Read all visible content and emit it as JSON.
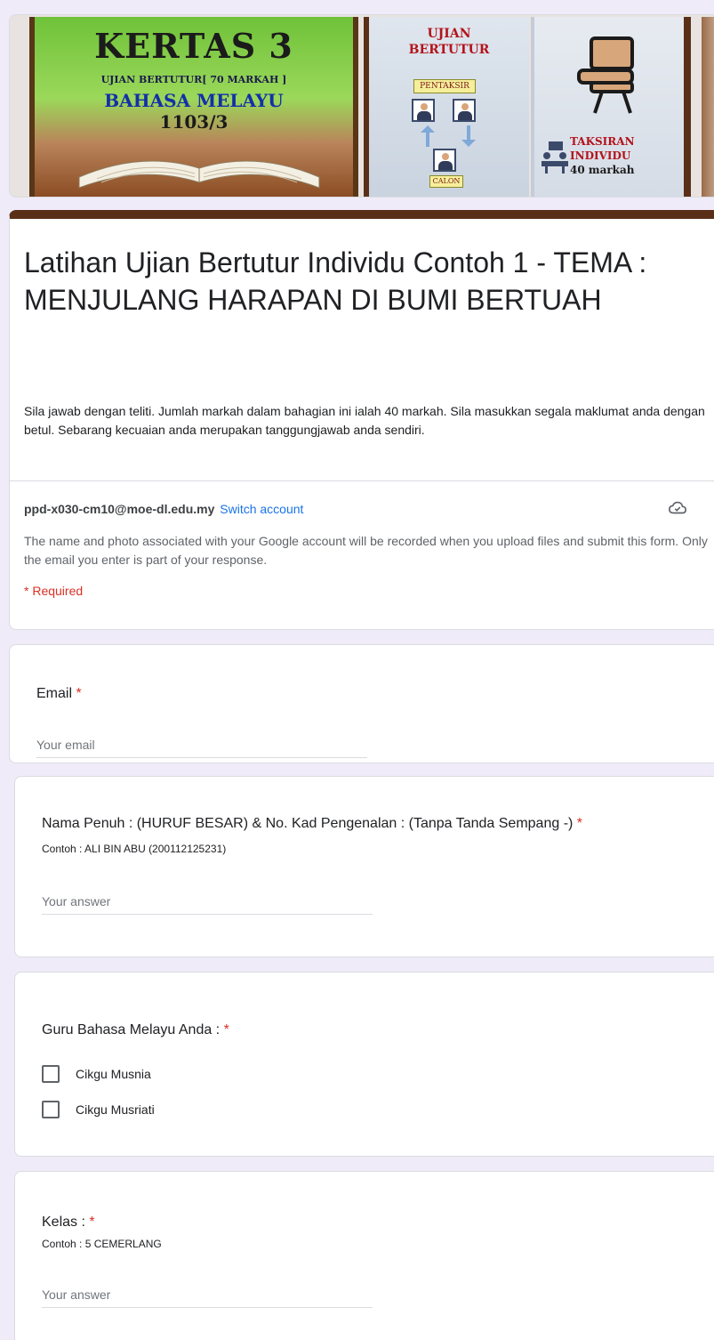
{
  "banner": {
    "left": {
      "title": "KERTAS 3",
      "subtitle": "UJIAN BERTUTUR[ 70 MARKAH ]",
      "subject": "BAHASA MELAYU",
      "code": "1103/3"
    },
    "middle": {
      "line1": "UJIAN",
      "line2": "BERTUTUR",
      "pentaksir": "PENTAKSIR",
      "calon": "CALON"
    },
    "right": {
      "line1": "TAKSIRAN",
      "line2": "INDIVIDU",
      "line3": "40 markah"
    }
  },
  "form": {
    "title": "Latihan Ujian Bertutur Individu Contoh 1 - TEMA : MENJULANG HARAPAN DI BUMI BERTUAH",
    "description": "Sila jawab dengan teliti. Jumlah markah dalam bahagian ini ialah 40 markah. Sila masukkan segala maklumat anda dengan betul. Sebarang kecuaian anda merupakan tanggungjawab anda sendiri.",
    "account_email": "ppd-x030-cm10@moe-dl.edu.my",
    "switch_account": "Switch account",
    "account_note": "The name and photo associated with your Google account will be recorded when you upload files and submit this form. Only the email you enter is part of your response.",
    "required_note": "* Required",
    "theme_color": "#5a2f18"
  },
  "questions": {
    "email": {
      "label": "Email",
      "star": "*",
      "placeholder": "Your email"
    },
    "name": {
      "label": "Nama Penuh : (HURUF BESAR) & No. Kad Pengenalan : (Tanpa Tanda Sempang -)",
      "star": "*",
      "help": "Contoh : ALI BIN ABU (200112125231)",
      "placeholder": "Your answer"
    },
    "teacher": {
      "label": "Guru Bahasa Melayu Anda :",
      "star": "*",
      "options": [
        "Cikgu Musnia",
        "Cikgu Musriati"
      ]
    },
    "kelas": {
      "label": "Kelas :",
      "star": "*",
      "help": "Contoh : 5 CEMERLANG",
      "placeholder": "Your answer"
    }
  }
}
